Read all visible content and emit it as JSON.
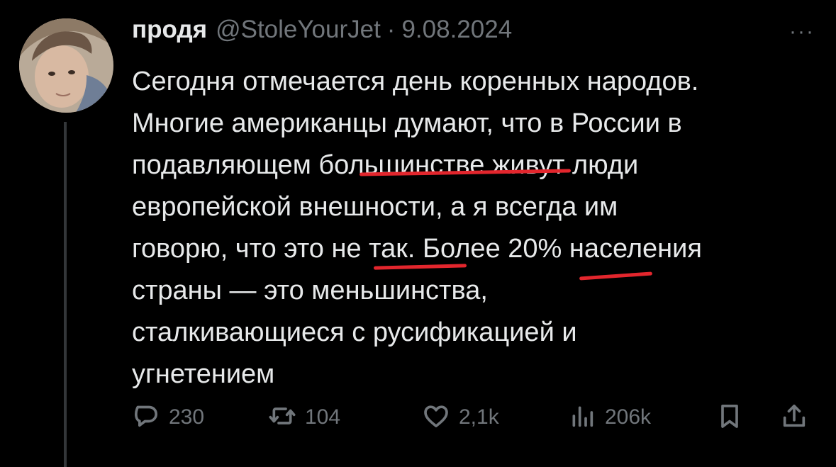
{
  "tweet": {
    "author": {
      "display_name": "продя",
      "handle": "@StoleYourJet",
      "separator": "·",
      "date": "9.08.2024"
    },
    "text_lines": [
      "Сегодня отмечается день коренных народов.",
      "Многие американцы думают, что в России в",
      "подавляющем большинстве живут люди",
      "европейской внешности, а я всегда им",
      "говорю, что это не так. Более 20% населения",
      "страны — это меньшинства,",
      "сталкивающиеся с русификацией и",
      "угнетением"
    ],
    "more_label": "···",
    "stats": {
      "replies": "230",
      "reposts": "104",
      "likes": "2,1k",
      "views": "206k"
    }
  },
  "icons": {
    "reply": "reply-icon",
    "repost": "repost-icon",
    "like": "heart-icon",
    "views": "views-icon",
    "bookmark": "bookmark-icon",
    "share": "share-icon",
    "more": "more-icon"
  },
  "colors": {
    "background": "#000000",
    "text_primary": "#e7e9ea",
    "text_secondary": "#71767b",
    "annotation": "#e3262d"
  }
}
